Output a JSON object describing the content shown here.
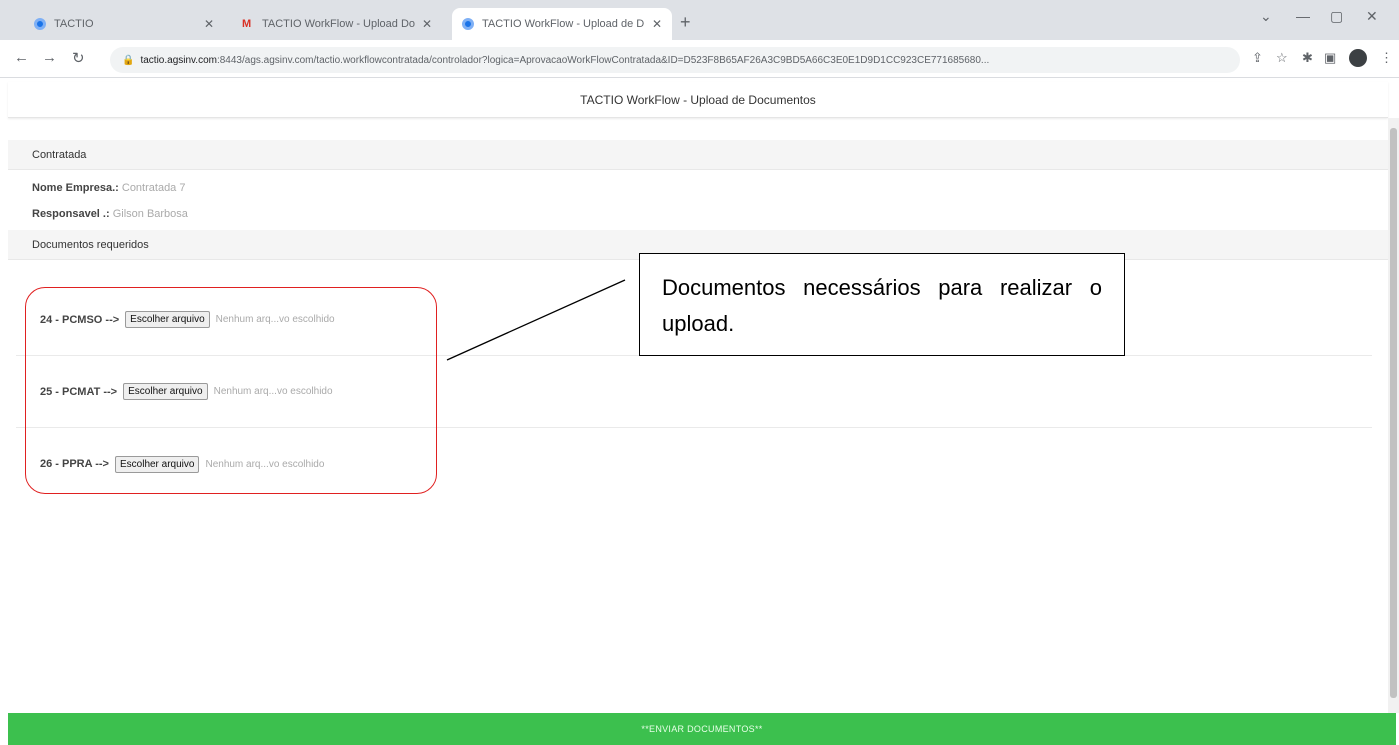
{
  "browser": {
    "tabs": [
      {
        "title": "TACTIO",
        "icon": "tactio-favicon"
      },
      {
        "title": "TACTIO WorkFlow - Upload Do...",
        "icon": "gmail-icon"
      },
      {
        "title": "TACTIO WorkFlow - Upload de D",
        "icon": "tactio-favicon"
      }
    ],
    "url_host": "tactio.agsinv.com",
    "url_rest": ":8443/ags.agsinv.com/tactio.workflowcontratada/controlador?logica=AprovacaoWorkFlowContratada&ID=D523F8B65AF26A3C9BD5A66C3E0E1D9D1CC923CE771685680..."
  },
  "page": {
    "header_title": "TACTIO WorkFlow - Upload de Documentos",
    "contratada_section": "Contratada",
    "nome_empresa_label": "Nome Empresa.:",
    "nome_empresa_value": "Contratada 7",
    "responsavel_label": "Responsavel .:",
    "responsavel_value": "Gilson Barbosa",
    "documentos_section": "Documentos requeridos",
    "documents": [
      {
        "label": "24 - PCMSO -->",
        "button": "Escolher arquivo",
        "status": "Nenhum arq...vo escolhido"
      },
      {
        "label": "25 - PCMAT -->",
        "button": "Escolher arquivo",
        "status": "Nenhum arq...vo escolhido"
      },
      {
        "label": "26 - PPRA -->",
        "button": "Escolher arquivo",
        "status": "Nenhum arq...vo escolhido"
      }
    ],
    "submit_label": "**ENVIAR DOCUMENTOS**"
  },
  "annotation": {
    "callout_text": "Documentos necessários para realizar o upload."
  },
  "colors": {
    "submit_bg": "#3cc04e",
    "outline": "#e02020"
  }
}
